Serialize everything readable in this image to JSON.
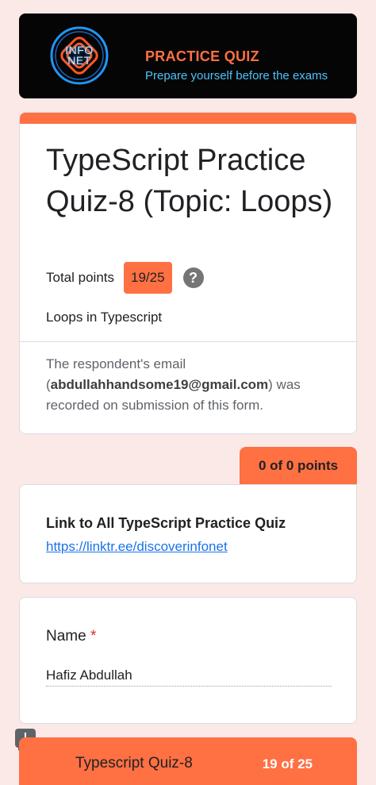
{
  "banner": {
    "logo_line1": "INFO",
    "logo_line2": "NET",
    "title": "PRACTICE QUIZ",
    "subtitle": "Prepare yourself before the exams"
  },
  "quiz": {
    "title": "TypeScript Practice Quiz-8 (Topic: Loops)",
    "points_label": "Total points",
    "points_value": "19/25",
    "help_icon": "?",
    "description": "Loops in Typescript",
    "email_prefix": "The respondent's email (",
    "email": "abdullahhandsome19@gmail.com",
    "email_suffix": ") was recorded on submission of this form."
  },
  "section": {
    "points": "0 of 0 points",
    "link_title": "Link to All TypeScript Practice Quiz",
    "link_url": "https://linktr.ee/discoverinfonet"
  },
  "name_question": {
    "label": "Name",
    "required_mark": "*",
    "answer": "Hafiz Abdullah"
  },
  "next_section": {
    "title": "Typescript Quiz-8",
    "score": "19 of 25"
  },
  "feedback_icon": "!",
  "colors": {
    "accent": "#ff7043",
    "background": "#fbe9e7",
    "link": "#1a73e8",
    "banner_bg": "#050505"
  }
}
